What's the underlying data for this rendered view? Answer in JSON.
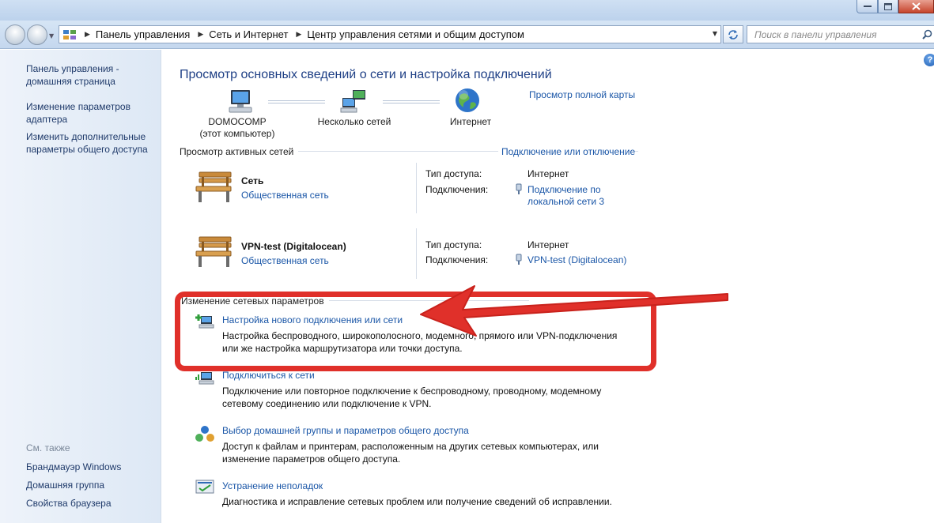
{
  "address_bar": {
    "crumbs": [
      "Панель управления",
      "Сеть и Интернет",
      "Центр управления сетями и общим доступом"
    ],
    "search_placeholder": "Поиск в панели управления"
  },
  "sidebar": {
    "home_link": "Панель управления - домашняя страница",
    "adapter_link": "Изменение параметров адаптера",
    "sharing_link": "Изменить дополнительные параметры общего доступа",
    "see_also_heading": "См. также",
    "see_also": [
      "Брандмауэр Windows",
      "Домашняя группа",
      "Свойства браузера"
    ]
  },
  "main": {
    "title": "Просмотр основных сведений о сети и настройка подключений",
    "full_map_link": "Просмотр полной карты",
    "map": {
      "computer_name": "DOMOCOMP",
      "computer_sub": "(этот компьютер)",
      "middle": "Несколько сетей",
      "internet": "Интернет"
    },
    "active_networks_label": "Просмотр активных сетей",
    "connect_link": "Подключение или отключение",
    "networks": [
      {
        "name": "Сеть",
        "type": "Общественная сеть",
        "access_label": "Тип доступа:",
        "access_value": "Интернет",
        "conn_label": "Подключения:",
        "conn_value_1": "Подключение по",
        "conn_value_2": "локальной сети 3"
      },
      {
        "name": "VPN-test (Digitalocean)",
        "type": "Общественная сеть",
        "access_label": "Тип доступа:",
        "access_value": "Интернет",
        "conn_label": "Подключения:",
        "conn_value_1": "VPN-test (Digitalocean)"
      }
    ],
    "change_settings_label": "Изменение сетевых параметров",
    "tasks": [
      {
        "link": "Настройка нового подключения или сети",
        "desc_1": "Настройка беспроводного, широкополосного, модемного, прямого или VPN-подключения",
        "desc_2": "или же настройка маршрутизатора или точки доступа."
      },
      {
        "link": "Подключиться к сети",
        "desc_1": "Подключение или повторное подключение к беспроводному, проводному, модемному",
        "desc_2": "сетевому соединению или подключение к VPN."
      },
      {
        "link": "Выбор домашней группы и параметров общего доступа",
        "desc_1": "Доступ к файлам и принтерам, расположенным на других сетевых компьютерах, или",
        "desc_2": "изменение параметров общего доступа."
      },
      {
        "link": "Устранение неполадок",
        "desc_1": "Диагностика и исправление сетевых проблем или получение сведений об исправлении."
      }
    ]
  },
  "colors": {
    "link": "#1a56a7",
    "title": "#1e3f85",
    "annotation": "#e0302a"
  }
}
